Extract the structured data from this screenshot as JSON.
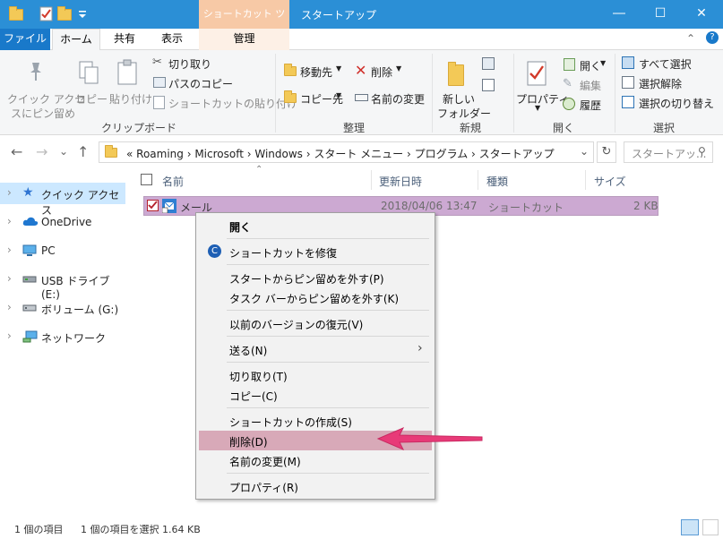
{
  "titlebar": {
    "context_tab_header": "ショートカット ツール",
    "window_title": "スタートアップ",
    "minimize": "―",
    "maximize": "☐",
    "close": "✕",
    "bg_color": "#2b8fd6"
  },
  "ribbon_tabs": {
    "file": "ファイル",
    "home": "ホーム",
    "share": "共有",
    "view": "表示",
    "manage": "管理"
  },
  "ribbon": {
    "clipboard": {
      "pin_quick_access": [
        "クイック アクセ",
        "スにピン留め"
      ],
      "copy": "コピー",
      "paste": "貼り付け",
      "cut": "切り取り",
      "copy_path": "パスのコピー",
      "paste_shortcut": "ショートカットの貼り付け",
      "group_label": "クリップボード"
    },
    "organize": {
      "move_to": "移動先",
      "copy_to": "コピー先",
      "delete": "削除",
      "rename": "名前の変更",
      "group_label": "整理"
    },
    "new": {
      "new_folder": [
        "新しい",
        "フォルダー"
      ],
      "group_label": "新規"
    },
    "open": {
      "properties": "プロパティ",
      "open": "開く",
      "edit": "編集",
      "history": "履歴",
      "group_label": "開く"
    },
    "select": {
      "select_all": "すべて選択",
      "select_none": "選択解除",
      "invert_selection": "選択の切り替え",
      "group_label": "選択"
    }
  },
  "address": {
    "back": "←",
    "forward": "→",
    "recent": "⌄",
    "up": "↑",
    "breadcrumb": "«  Roaming  ›  Microsoft  ›  Windows  ›  スタート メニュー  ›  プログラム  ›  スタートアップ",
    "dropdown": "⌄",
    "refresh": "↻",
    "search_placeholder": "スタートアッ..."
  },
  "nav": {
    "items": [
      {
        "label": "クイック アクセス",
        "icon": "star-icon"
      },
      {
        "label": "OneDrive",
        "icon": "cloud-icon"
      },
      {
        "label": "PC",
        "icon": "monitor-icon"
      },
      {
        "label": "USB ドライブ (E:)",
        "icon": "usb-drive-icon"
      },
      {
        "label": "ボリューム (G:)",
        "icon": "drive-icon"
      },
      {
        "label": "ネットワーク",
        "icon": "network-icon"
      }
    ]
  },
  "columns": {
    "name": "名前",
    "date": "更新日時",
    "type": "種類",
    "size": "サイズ"
  },
  "files": [
    {
      "name": "メール",
      "date": "2018/04/06 13:47",
      "type": "ショートカット",
      "size": "2 KB"
    }
  ],
  "context_menu": {
    "open": "開く",
    "fix_shortcut": "ショートカットを修復",
    "unpin_start": "スタートからピン留めを外す(P)",
    "unpin_taskbar": "タスク バーからピン留めを外す(K)",
    "restore_previous": "以前のバージョンの復元(V)",
    "send_to": "送る(N)",
    "cut": "切り取り(T)",
    "copy": "コピー(C)",
    "create_shortcut": "ショートカットの作成(S)",
    "delete": "削除(D)",
    "rename": "名前の変更(M)",
    "properties": "プロパティ(R)",
    "highlight_color": "#d8a9b8"
  },
  "annotation": {
    "arrow_color": "#e83a78"
  },
  "status": {
    "item_count": "1 個の項目",
    "selected": "1 個の項目を選択  1.64 KB"
  }
}
